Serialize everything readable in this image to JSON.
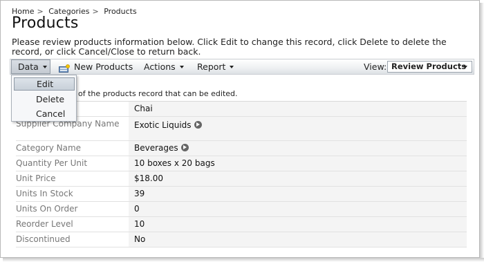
{
  "breadcrumb": {
    "items": [
      "Home",
      "Categories",
      "Products"
    ],
    "separator": ">"
  },
  "page": {
    "title": "Products",
    "description": "Please review products information below. Click Edit to change this record, click Delete to delete the record, or click Cancel/Close to return back."
  },
  "toolbar": {
    "data_label": "Data",
    "new_products_label": "New Products",
    "actions_label": "Actions",
    "report_label": "Report",
    "view_label": "View:",
    "view_value": "Review Products"
  },
  "data_menu": {
    "items": [
      "Edit",
      "Delete",
      "Cancel"
    ],
    "highlighted": "Edit"
  },
  "form": {
    "hint": "of the products record that can be edited.",
    "fields": [
      {
        "label": "",
        "value": "Chai"
      },
      {
        "label": "Supplier Company Name",
        "value": "Exotic Liquids",
        "link": true
      },
      {
        "label": "Category Name",
        "value": "Beverages",
        "link": true
      },
      {
        "label": "Quantity Per Unit",
        "value": "10 boxes x 20 bags"
      },
      {
        "label": "Unit Price",
        "value": "$18.00"
      },
      {
        "label": "Units In Stock",
        "value": "39"
      },
      {
        "label": "Units On Order",
        "value": "0"
      },
      {
        "label": "Reorder Level",
        "value": "10"
      },
      {
        "label": "Discontinued",
        "value": "No"
      }
    ]
  },
  "icons": {
    "new_products": "new-record-icon",
    "field_link": "go-arrow-icon",
    "dropdown": "chevron-down-icon"
  },
  "colors": {
    "toolbar_bg": "#eef0f2",
    "menu_highlight": "#c8d0d9",
    "value_bg": "#f4f4f4",
    "label_text": "#777777"
  }
}
